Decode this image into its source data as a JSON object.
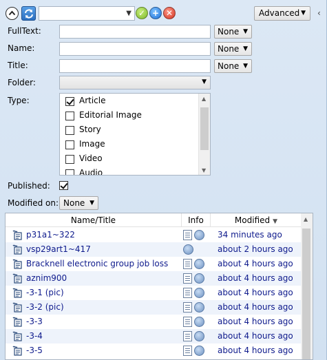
{
  "toolbar": {
    "query_value": "",
    "advanced_label": "Advanced"
  },
  "form": {
    "fulltext": {
      "label": "FullText:",
      "value": "",
      "mode": "None"
    },
    "name": {
      "label": "Name:",
      "value": "",
      "mode": "None"
    },
    "title": {
      "label": "Title:",
      "value": "",
      "mode": "None"
    },
    "folder": {
      "label": "Folder:",
      "value": ""
    },
    "type": {
      "label": "Type:",
      "items": [
        {
          "label": "Article",
          "checked": true
        },
        {
          "label": "Editorial Image",
          "checked": false
        },
        {
          "label": "Story",
          "checked": false
        },
        {
          "label": "Image",
          "checked": false
        },
        {
          "label": "Video",
          "checked": false
        },
        {
          "label": "Audio",
          "checked": false
        }
      ]
    },
    "published": {
      "label": "Published:",
      "checked": true
    },
    "modified_on": {
      "label": "Modified on:",
      "value": "None"
    }
  },
  "grid": {
    "columns": {
      "name": "Name/Title",
      "info": "Info",
      "modified": "Modified"
    },
    "rows": [
      {
        "title": "p31a1~322",
        "modified": "34 minutes ago",
        "has_doc": true
      },
      {
        "title": "vsp29art1~417",
        "modified": "about 2 hours ago",
        "has_doc": false
      },
      {
        "title": "Bracknell electronic group job loss",
        "modified": "about 4 hours ago",
        "has_doc": true
      },
      {
        "title": "aznim900",
        "modified": "about 4 hours ago",
        "has_doc": true
      },
      {
        "title": "-3-1 (pic)",
        "modified": "about 4 hours ago",
        "has_doc": true
      },
      {
        "title": "-3-2 (pic)",
        "modified": "about 4 hours ago",
        "has_doc": true
      },
      {
        "title": "-3-3",
        "modified": "about 4 hours ago",
        "has_doc": true
      },
      {
        "title": "-3-4",
        "modified": "about 4 hours ago",
        "has_doc": true
      },
      {
        "title": "-3-5",
        "modified": "about 4 hours ago",
        "has_doc": true
      }
    ]
  },
  "colors": {
    "panel_bg": "#d6e4f2",
    "link_text": "#0e1a8c",
    "alt_row": "#eef3fb"
  }
}
